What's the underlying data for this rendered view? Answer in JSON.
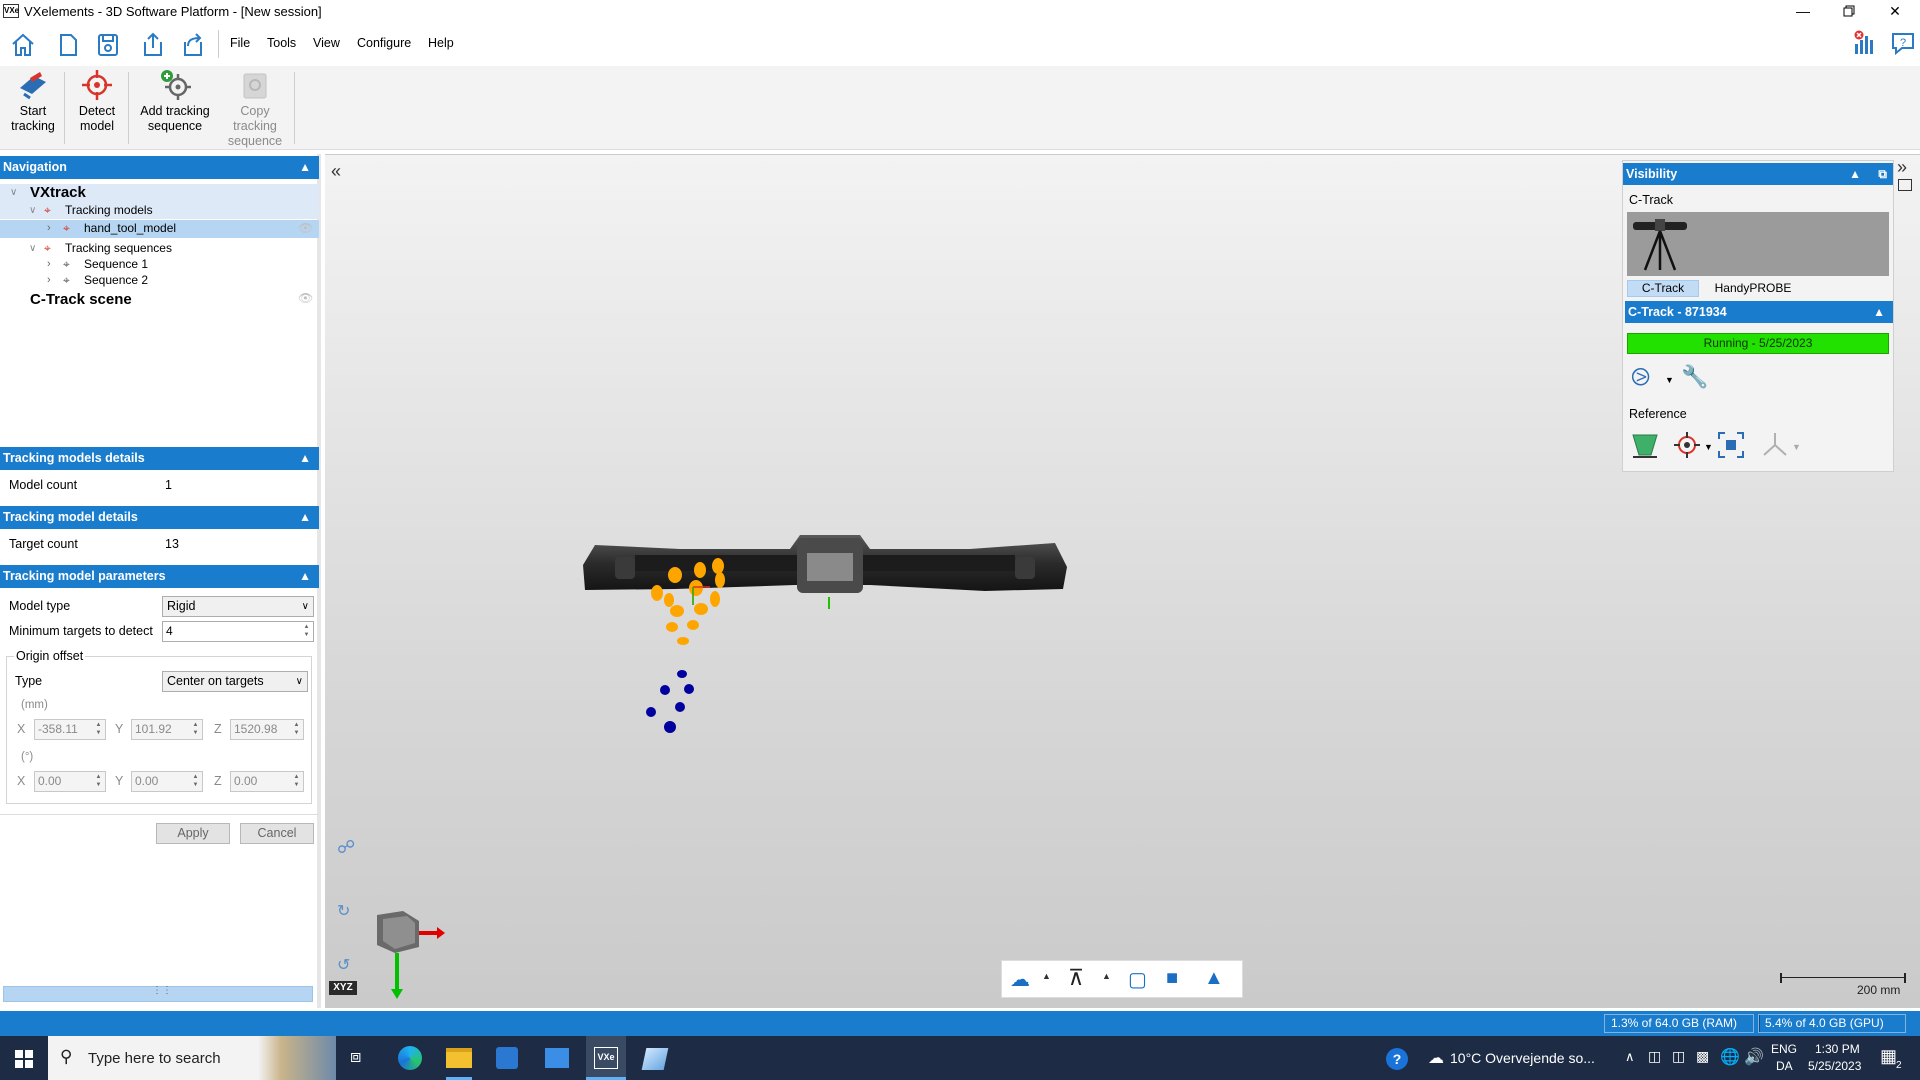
{
  "window": {
    "title": "VXelements - 3D Software Platform - [New session]",
    "app_icon_text": "VXe"
  },
  "menu": [
    "File",
    "Tools",
    "View",
    "Configure",
    "Help"
  ],
  "ribbon": {
    "start_tracking": [
      "Start",
      "tracking"
    ],
    "detect_model": [
      "Detect",
      "model"
    ],
    "add_tracking_sequence": [
      "Add tracking",
      "sequence"
    ],
    "copy_tracking_sequence": [
      "Copy",
      "tracking",
      "sequence"
    ]
  },
  "navigation": {
    "header": "Navigation",
    "root": "VXtrack",
    "tracking_models": "Tracking models",
    "model_item": "hand_tool_model",
    "tracking_sequences": "Tracking sequences",
    "sequence_1": "Sequence 1",
    "sequence_2": "Sequence 2",
    "scene": "C-Track scene"
  },
  "models_details": {
    "header": "Tracking models details",
    "label": "Model count",
    "value": "1"
  },
  "model_details": {
    "header": "Tracking model details",
    "label": "Target count",
    "value": "13"
  },
  "params": {
    "header": "Tracking model parameters",
    "model_type_label": "Model type",
    "model_type_value": "Rigid",
    "min_targets_label": "Minimum targets to detect",
    "min_targets_value": "4",
    "origin_offset_label": "Origin offset",
    "type_label": "Type",
    "type_value": "Center on targets",
    "unit_mm": "(mm)",
    "unit_deg": "(°)",
    "x_label": "X",
    "y_label": "Y",
    "z_label": "Z",
    "pos_x": "-358.11",
    "pos_y": "101.92",
    "pos_z": "1520.98",
    "rot_x": "0.00",
    "rot_y": "0.00",
    "rot_z": "0.00",
    "apply": "Apply",
    "cancel": "Cancel"
  },
  "visibility": {
    "header": "Visibility",
    "device_label": "C-Track",
    "tab_ctrack": "C-Track",
    "tab_handyprobe": "HandyPROBE",
    "ctrack_header": "C-Track - 871934",
    "status": "Running - 5/25/2023",
    "reference_label": "Reference"
  },
  "viewport": {
    "axis_label": "XYZ",
    "scale_label": "200 mm"
  },
  "status": {
    "ram": "1.3% of 64.0 GB (RAM)",
    "gpu": "5.4% of 4.0 GB (GPU)",
    "ram_fraction": 0.013,
    "gpu_fraction": 0.054
  },
  "taskbar": {
    "search_placeholder": "Type here to search",
    "weather": "10°C  Overvejende so...",
    "lang_1": "ENG",
    "lang_2": "DA",
    "time": "1:30 PM",
    "date": "5/25/2023",
    "notifications": "2"
  },
  "colors": {
    "accent": "#1a7ccc",
    "running": "#22e000",
    "target_orange": "#ffa500",
    "target_blue": "#00009e"
  }
}
